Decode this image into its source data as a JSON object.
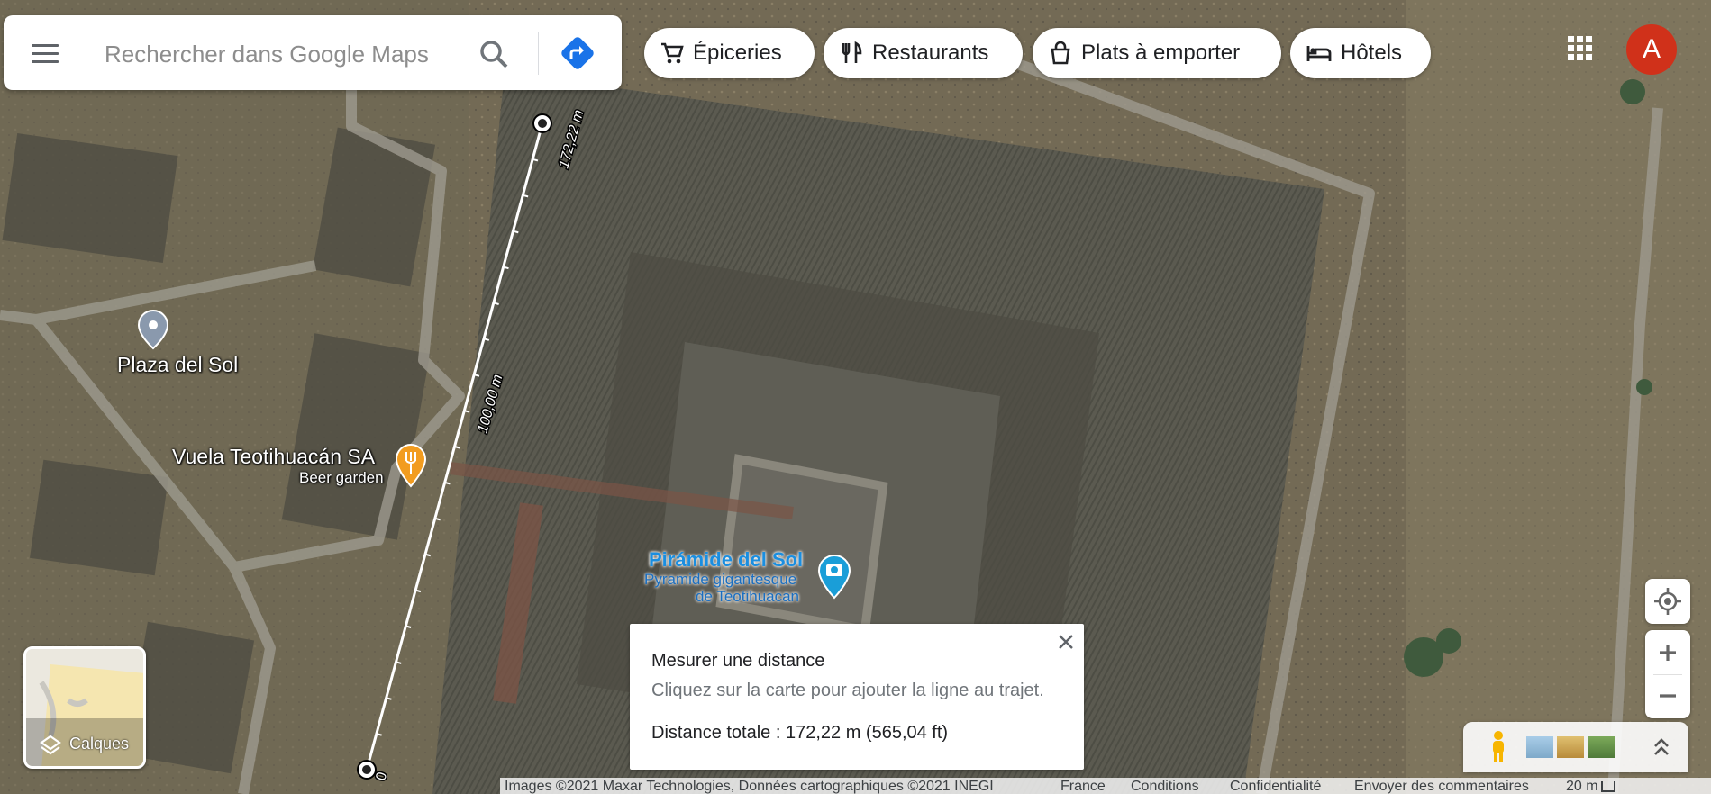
{
  "search": {
    "placeholder": "Rechercher dans Google Maps",
    "value": ""
  },
  "chips": [
    {
      "label": "Épiceries",
      "icon": "cart-icon"
    },
    {
      "label": "Restaurants",
      "icon": "fork-knife-icon"
    },
    {
      "label": "Plats à emporter",
      "icon": "takeout-bag-icon"
    },
    {
      "label": "Hôtels",
      "icon": "bed-icon"
    }
  ],
  "account": {
    "initial": "A",
    "color": "#d0311a"
  },
  "map": {
    "view": "satellite",
    "places": [
      {
        "name": "Plaza del Sol",
        "icon": "place-pin-icon"
      },
      {
        "name": "Vuela Teotihuacán SA",
        "category": "Beer garden",
        "icon": "restaurant-pin-icon",
        "color": "#f29c1f"
      },
      {
        "name": "Pirámide del Sol",
        "subtitle_line1": "Pyramide gigantesque",
        "subtitle_line2": "de Teotihuacan",
        "icon": "photo-pin-icon",
        "color": "#1a9ed8"
      }
    ],
    "measurement": {
      "start_label": "0",
      "mid_label": "100,00 m",
      "end_label": "172,22 m"
    }
  },
  "layers": {
    "label": "Calques",
    "icon": "layers-icon"
  },
  "measure_panel": {
    "title": "Mesurer une distance",
    "hint": "Cliquez sur la carte pour ajouter la ligne au trajet.",
    "total": "Distance totale : 172,22 m (565,04 ft)"
  },
  "footer": {
    "imagery": "Images ©2021 Maxar Technologies, Données cartographiques ©2021 INEGI",
    "country": "France",
    "terms": "Conditions",
    "privacy": "Confidentialité",
    "feedback": "Envoyer des commentaires",
    "scale": "20 m"
  }
}
